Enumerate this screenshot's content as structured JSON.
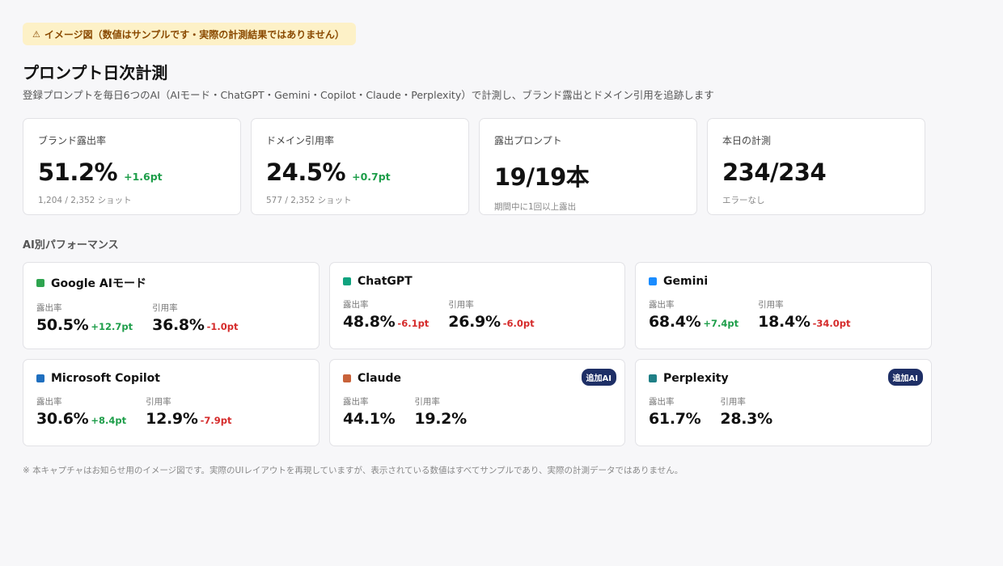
{
  "notice": {
    "icon": "warning-icon",
    "text": "イメージ図（数値はサンプルです・実際の計測結果ではありません）"
  },
  "header": {
    "title": "プロンプト日次計測",
    "subtitle": "登録プロンプトを毎日6つのAI（AIモード・ChatGPT・Gemini・Copilot・Claude・Perplexity）で計測し、ブランド露出とドメイン引用を追跡します"
  },
  "kpis": [
    {
      "label": "ブランド露出率",
      "value": "51.2%",
      "delta": "+1.6pt",
      "delta_dir": "pos",
      "sub": "1,204 / 2,352 ショット"
    },
    {
      "label": "ドメイン引用率",
      "value": "24.5%",
      "delta": "+0.7pt",
      "delta_dir": "pos",
      "sub": "577 / 2,352 ショット"
    },
    {
      "label": "露出プロンプト",
      "value": "19/19本",
      "delta": "",
      "delta_dir": "",
      "sub": "期間中に1回以上露出"
    },
    {
      "label": "本日の計測",
      "value": "234/234",
      "delta": "",
      "delta_dir": "",
      "sub": "エラーなし"
    }
  ],
  "ai_section": {
    "title": "AI別パフォーマンス",
    "exposure_label": "露出率",
    "citation_label": "引用率",
    "cards": [
      {
        "name": "Google AIモード",
        "color": "#2ea44f",
        "badge": "",
        "exposure": "50.5%",
        "exposure_delta": "+12.7pt",
        "exposure_dir": "pos",
        "citation": "36.8%",
        "citation_delta": "-1.0pt",
        "citation_dir": "neg"
      },
      {
        "name": "ChatGPT",
        "color": "#10a37f",
        "badge": "",
        "exposure": "48.8%",
        "exposure_delta": "-6.1pt",
        "exposure_dir": "neg",
        "citation": "26.9%",
        "citation_delta": "-6.0pt",
        "citation_dir": "neg"
      },
      {
        "name": "Gemini",
        "color": "#1a8cff",
        "badge": "",
        "exposure": "68.4%",
        "exposure_delta": "+7.4pt",
        "exposure_dir": "pos",
        "citation": "18.4%",
        "citation_delta": "-34.0pt",
        "citation_dir": "neg"
      },
      {
        "name": "Microsoft Copilot",
        "color": "#1f6fbf",
        "badge": "",
        "exposure": "30.6%",
        "exposure_delta": "+8.4pt",
        "exposure_dir": "pos",
        "citation": "12.9%",
        "citation_delta": "-7.9pt",
        "citation_dir": "neg"
      },
      {
        "name": "Claude",
        "color": "#c8623a",
        "badge": "追加AI",
        "exposure": "44.1%",
        "exposure_delta": "",
        "exposure_dir": "",
        "citation": "19.2%",
        "citation_delta": "",
        "citation_dir": ""
      },
      {
        "name": "Perplexity",
        "color": "#1f7f86",
        "badge": "追加AI",
        "exposure": "61.7%",
        "exposure_delta": "",
        "exposure_dir": "",
        "citation": "28.3%",
        "citation_delta": "",
        "citation_dir": ""
      }
    ]
  },
  "footnote": "※ 本キャプチャはお知らせ用のイメージ図です。実際のUIレイアウトを再現していますが、表示されている数値はすべてサンプルであり、実際の計測データではありません。"
}
